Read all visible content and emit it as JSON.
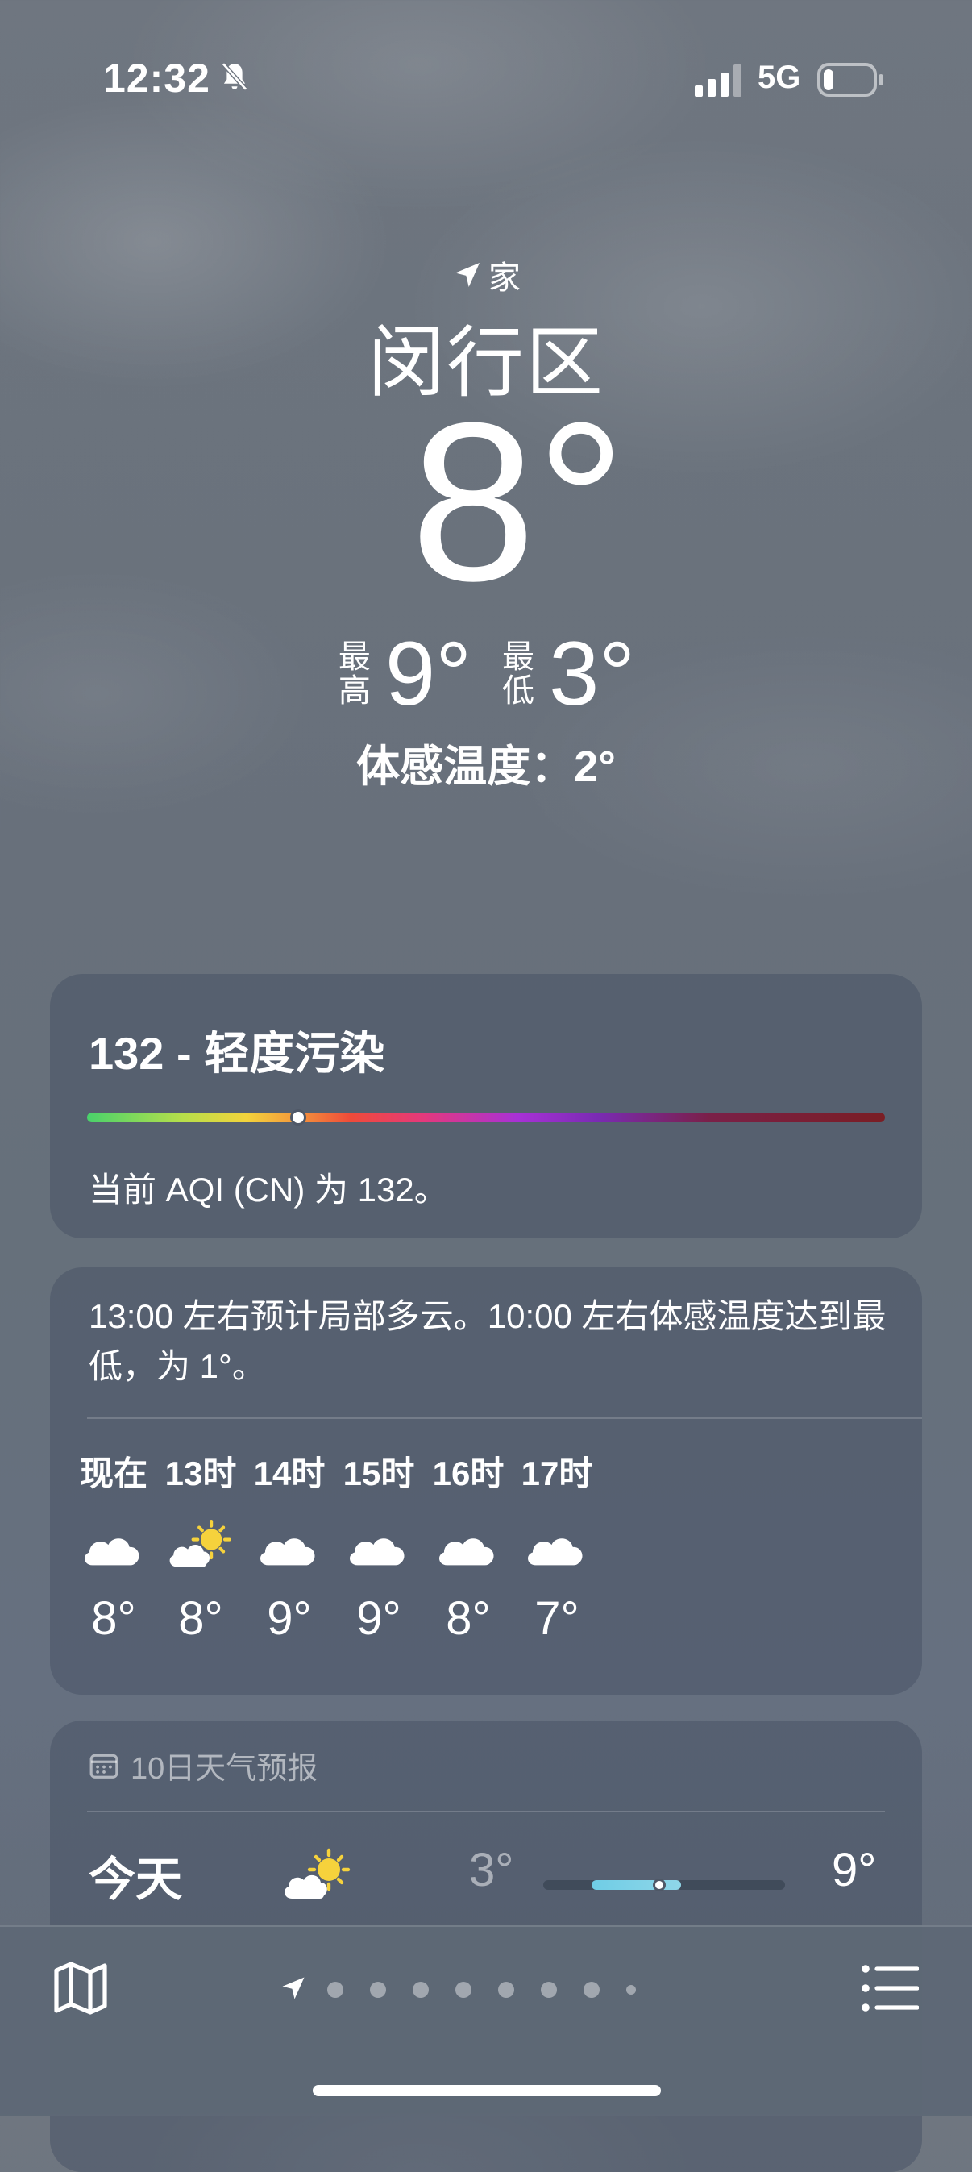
{
  "status_bar": {
    "time": "12:32",
    "network": "5G",
    "icons": [
      "bell-slash-icon",
      "cellular-signal-icon",
      "battery-low-icon"
    ]
  },
  "location": {
    "tag": "家",
    "tag_icon": "location-arrow-icon",
    "city": "闵行区",
    "temperature": "8°",
    "high_label_top": "最",
    "high_label_bottom": "高",
    "high": "9°",
    "low_label_top": "最",
    "low_label_bottom": "低",
    "low": "3°",
    "feels_like": "体感温度：2°"
  },
  "aqi": {
    "title": "132 - 轻度污染",
    "value": 132,
    "scale_position": 0.265,
    "description": "当前 AQI (CN) 为 132。"
  },
  "hourly": {
    "summary": "13:00 左右预计局部多云。10:00 左右体感温度达到最低，为 1°。",
    "hours": [
      {
        "label": "现在",
        "icon": "cloud-icon",
        "temp": "8°"
      },
      {
        "label": "13时",
        "icon": "partly-sunny-icon",
        "temp": "8°"
      },
      {
        "label": "14时",
        "icon": "cloud-icon",
        "temp": "9°"
      },
      {
        "label": "15时",
        "icon": "cloud-icon",
        "temp": "9°"
      },
      {
        "label": "16时",
        "icon": "cloud-icon",
        "temp": "8°"
      },
      {
        "label": "17时",
        "icon": "cloud-icon",
        "temp": "7°"
      }
    ]
  },
  "forecast": {
    "header": "10日天气预报",
    "header_icon": "calendar-icon",
    "days": [
      {
        "day": "今天",
        "icon": "partly-sunny-icon",
        "low": "3°",
        "high": "9°",
        "range_start": 0.2,
        "range_end": 0.57,
        "current": 0.48
      }
    ]
  },
  "bottom_bar": {
    "map_icon": "map-icon",
    "list_icon": "list-icon",
    "page_count": 8,
    "current_page": 0
  },
  "colors": {
    "background": "#6b737d",
    "card": "#485466",
    "range_fill": "#6fcde6"
  }
}
